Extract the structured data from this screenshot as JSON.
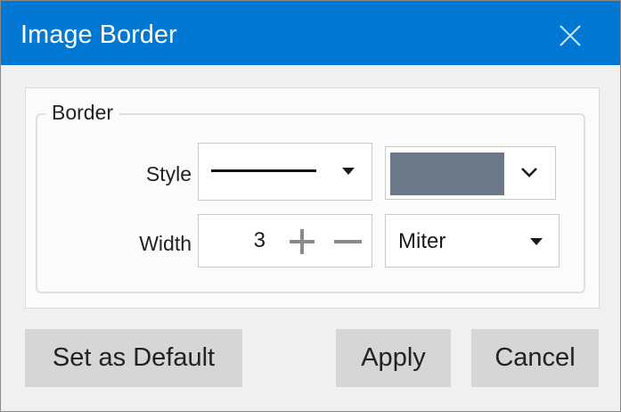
{
  "dialog": {
    "title": "Image Border",
    "close_icon": "close-icon"
  },
  "border_group": {
    "label": "Border",
    "style": {
      "label": "Style",
      "line_style": "solid",
      "color": "#6b7887"
    },
    "width": {
      "label": "Width",
      "value": "3",
      "increment_icon": "plus-icon",
      "decrement_icon": "minus-icon"
    },
    "join": {
      "value": "Miter"
    }
  },
  "buttons": {
    "set_default": "Set as Default",
    "apply": "Apply",
    "cancel": "Cancel"
  },
  "colors": {
    "titlebar": "#0078d4",
    "button_bg": "#d6d6d6"
  }
}
